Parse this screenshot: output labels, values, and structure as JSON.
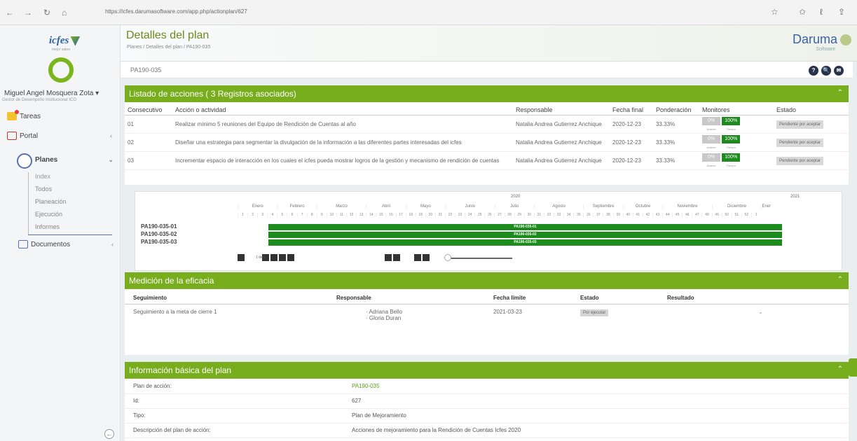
{
  "browser": {
    "url": "https://icfes.darumasoftware.com/app.php/actionplan/627",
    "nav": [
      "←",
      "→",
      "↻",
      "⌂"
    ],
    "actions": [
      "☆",
      "✩",
      "ℓ",
      "⇪"
    ]
  },
  "sidebar": {
    "logo": "icfes",
    "logo_sub": "mejor saber",
    "user_name": "Miguel Angel Mosquera Zota",
    "user_role": "Gestor de Desempeño Institucional ICO",
    "items": [
      {
        "label": "Tareas",
        "icon": "tasks-icon"
      },
      {
        "label": "Portal",
        "icon": "portal-icon"
      },
      {
        "label": "Planes",
        "icon": "plans-icon"
      },
      {
        "label": "Documentos",
        "icon": "documents-icon"
      }
    ],
    "subitems": [
      "Index",
      "Todos",
      "Planeación",
      "Ejecución",
      "Informes"
    ]
  },
  "header": {
    "title": "Detalles del plan",
    "breadcrumb": "Planes / Detalles del plan / PA190-035",
    "brand": "Daruma",
    "brand_sub": "Software"
  },
  "codebar": {
    "code": "PA190-035",
    "buttons": [
      "?",
      "🔍",
      "✉"
    ]
  },
  "actions_panel": {
    "title": "Listado de acciones ( 3 Registros asociados)",
    "headers": [
      "Consecutivo",
      "Acción o actividad",
      "Responsable",
      "Fecha final",
      "Ponderación",
      "Monitores",
      "Estado"
    ],
    "rows": [
      {
        "id": "01",
        "action": "Realizar mínimo 5 reuniones del Equipo de Rendición de Cuentas al año",
        "responsable": "Natalia Andrea Gutierrez Anchique",
        "fecha": "2020-12-23",
        "pond": "33.33%",
        "m1": "0%",
        "m2": "100%",
        "estado": "Pendiente por aceptar"
      },
      {
        "id": "02",
        "action": "Diseñar una estrategia para segmentar la divulgación de la información a las diferentes partes interesadas del icfes",
        "responsable": "Natalia Andrea Gutierrez Anchique",
        "fecha": "2020-12-23",
        "pond": "33.33%",
        "m1": "0%",
        "m2": "100%",
        "estado": "Pendiente por aceptar"
      },
      {
        "id": "03",
        "action": "Incrementar espacio de interacción en los cuales el icfes pueda mostrar logros de la gestión y mecanismo de rendición de cuentas",
        "responsable": "Natalia Andrea Gutierrez Anchique",
        "fecha": "2020-12-23",
        "pond": "33.33%",
        "m1": "0%",
        "m2": "100%",
        "estado": "Pendiente por aceptar"
      }
    ],
    "mon_labels": [
      "Avance",
      "Tiempo"
    ]
  },
  "gantt": {
    "year1": "2020",
    "year2": "2021",
    "months": [
      "Enero",
      "Febrero",
      "Marzo",
      "Abril",
      "Mayo",
      "Junio",
      "Julio",
      "Agosto",
      "Septiembre",
      "Octubre",
      "Noviembre",
      "Diciembre",
      "Ener"
    ],
    "weeks": [
      "1",
      "2",
      "3",
      "4",
      "5",
      "6",
      "7",
      "8",
      "9",
      "10",
      "11",
      "12",
      "13",
      "14",
      "15",
      "16",
      "17",
      "18",
      "19",
      "20",
      "21",
      "22",
      "23",
      "24",
      "25",
      "26",
      "27",
      "28",
      "29",
      "30",
      "31",
      "32",
      "33",
      "34",
      "35",
      "36",
      "37",
      "38",
      "39",
      "40",
      "41",
      "42",
      "43",
      "44",
      "45",
      "46",
      "47",
      "48",
      "49",
      "50",
      "51",
      "52",
      "1"
    ],
    "rows": [
      {
        "label": "PA190-035-01",
        "bar": "PA190-035-01"
      },
      {
        "label": "PA190-035-02",
        "bar": "PA190-035-02"
      },
      {
        "label": "PA190-035-03",
        "bar": "PA190-035-03"
      }
    ],
    "page": "1 de 1"
  },
  "eficacia": {
    "title": "Medición de la eficacia",
    "headers": [
      "Seguimiento",
      "Responsable",
      "Fecha límite",
      "Estado",
      "Resultado"
    ],
    "row": {
      "seguimiento": "Seguimiento a la meta de cierre 1",
      "resp1": "Adriana Bello",
      "resp2": "Gloria Duran",
      "fecha": "2021-03-23",
      "estado": "Por ejecutar"
    }
  },
  "info": {
    "title": "Información básica del plan",
    "rows": [
      {
        "label": "Plan de acción:",
        "value": "PA190-035"
      },
      {
        "label": "Id:",
        "value": "627"
      },
      {
        "label": "Tipo:",
        "value": "Plan de Mejoramiento"
      },
      {
        "label": "Descripción del plan de acción:",
        "value": "Acciones de mejoramiento para la Rendición de Cuentas Icfes 2020"
      }
    ]
  },
  "colors": {
    "accent": "#78ad1e",
    "bar": "#1c8c1c",
    "brand": "#3a62a8"
  }
}
